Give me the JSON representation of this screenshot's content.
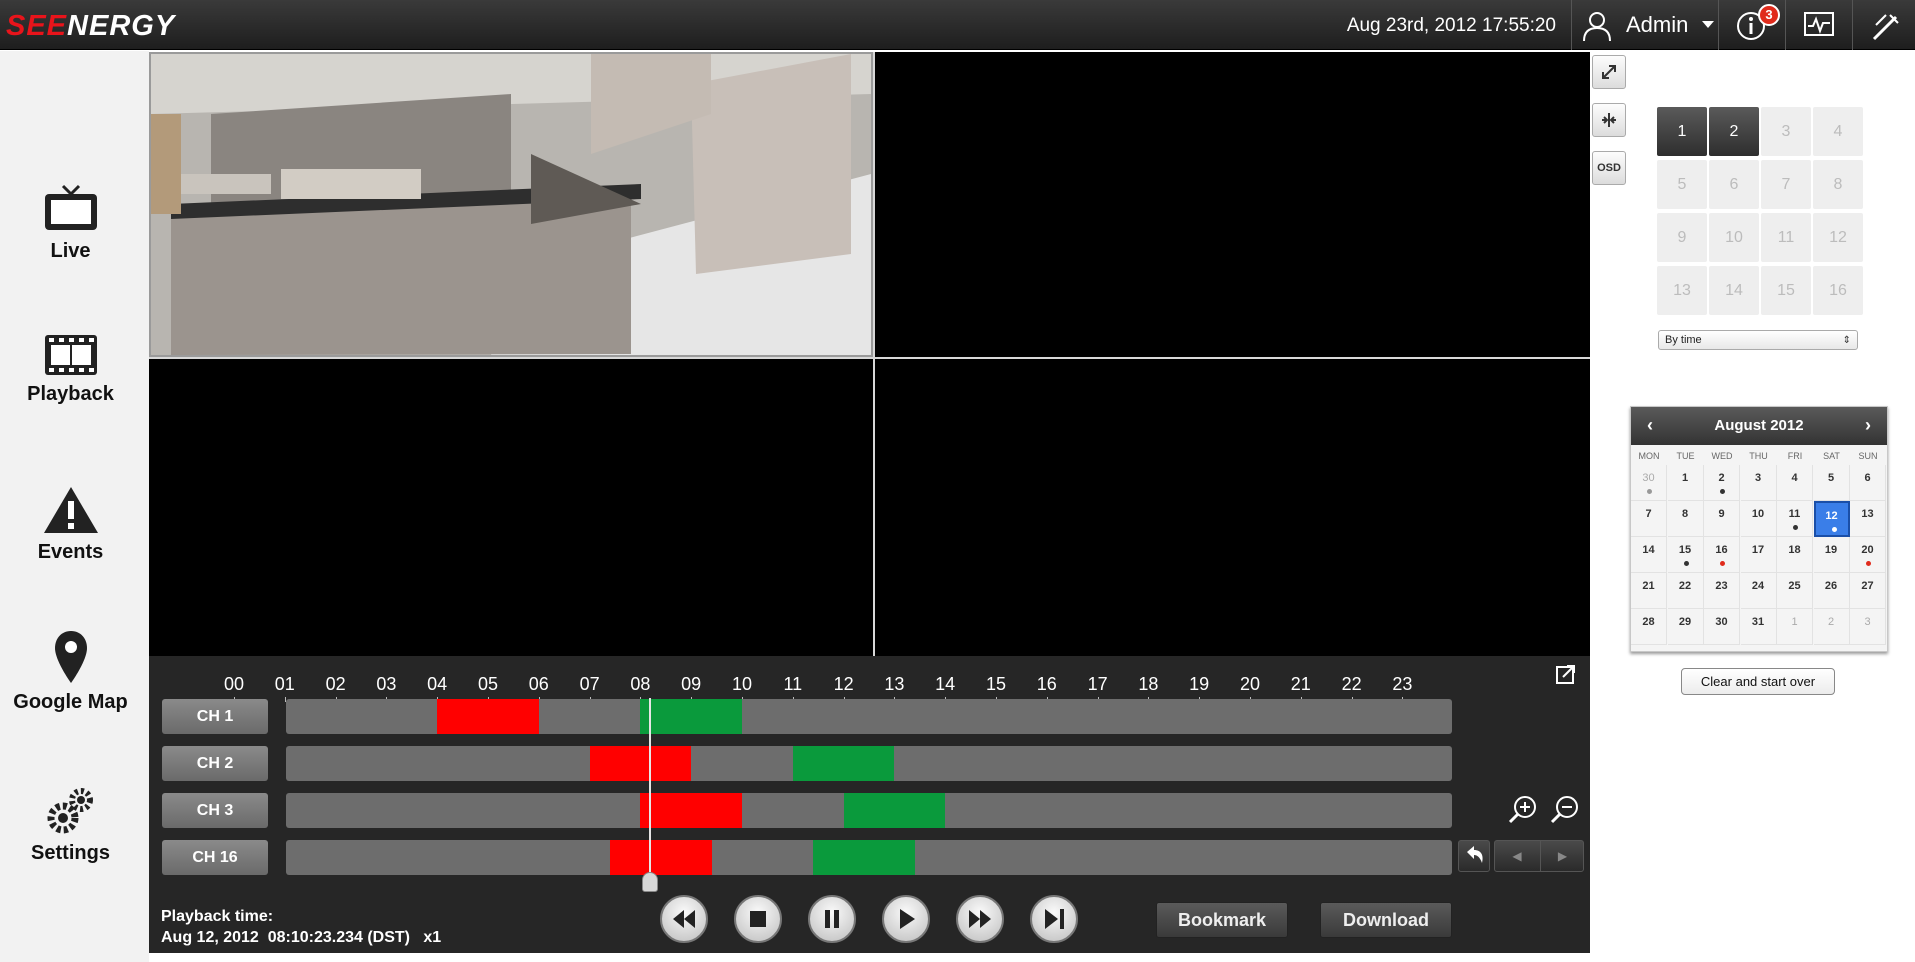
{
  "app": {
    "logo_prefix": "SEE",
    "logo_suffix": "NERGY"
  },
  "topbar": {
    "datetime": "Aug 23rd, 2012 17:55:20",
    "user": "Admin",
    "info_badge": "3",
    "icons": [
      "user-icon",
      "info-icon",
      "monitor-icon",
      "tools-icon"
    ]
  },
  "nav": [
    {
      "label": "Live",
      "icon": "tv-icon"
    },
    {
      "label": "Playback",
      "icon": "film-icon"
    },
    {
      "label": "Events",
      "icon": "warning-icon"
    },
    {
      "label": "Google Map",
      "icon": "map-pin-icon"
    },
    {
      "label": "Settings",
      "icon": "gears-icon"
    }
  ],
  "side_tools": {
    "fullscreen_icon": "expand-icon",
    "split_icon": "collapse-icon",
    "osd_label": "OSD"
  },
  "channels": {
    "labels": [
      "1",
      "2",
      "3",
      "4",
      "5",
      "6",
      "7",
      "8",
      "9",
      "10",
      "11",
      "12",
      "13",
      "14",
      "15",
      "16"
    ],
    "active": [
      "1",
      "2"
    ]
  },
  "mode_select": {
    "value": "By time"
  },
  "calendar": {
    "title": "August 2012",
    "weekdays": [
      "MON",
      "TUE",
      "WED",
      "THU",
      "FRI",
      "SAT",
      "SUN"
    ],
    "days": [
      "30",
      "1",
      "2",
      "3",
      "4",
      "5",
      "6",
      "7",
      "8",
      "9",
      "10",
      "11",
      "12",
      "13",
      "14",
      "15",
      "16",
      "17",
      "18",
      "19",
      "20",
      "21",
      "22",
      "23",
      "24",
      "25",
      "26",
      "27",
      "28",
      "29",
      "30",
      "31",
      "1",
      "2",
      "3"
    ],
    "selected": "12",
    "clear_label": "Clear and start over",
    "colors": {
      "dot_dark": "#333333",
      "dot_red": "#e02b1c",
      "dot_gray": "#999999",
      "selected": "#3a7ee8"
    }
  },
  "timeline": {
    "hours": [
      "00",
      "01",
      "02",
      "03",
      "04",
      "05",
      "06",
      "07",
      "08",
      "09",
      "10",
      "11",
      "12",
      "13",
      "14",
      "15",
      "16",
      "17",
      "18",
      "19",
      "20",
      "21",
      "22",
      "23"
    ],
    "channels": [
      {
        "label": "CH 1",
        "segments": [
          {
            "start": 4.0,
            "end": 6.0,
            "color": "#ff0000"
          },
          {
            "start": 8.0,
            "end": 10.0,
            "color": "#0a9a3c"
          }
        ]
      },
      {
        "label": "CH 2",
        "segments": [
          {
            "start": 7.0,
            "end": 9.0,
            "color": "#ff0000"
          },
          {
            "start": 11.0,
            "end": 13.0,
            "color": "#0a9a3c"
          }
        ]
      },
      {
        "label": "CH 3",
        "segments": [
          {
            "start": 8.0,
            "end": 10.0,
            "color": "#ff0000"
          },
          {
            "start": 12.0,
            "end": 14.0,
            "color": "#0a9a3c"
          }
        ]
      },
      {
        "label": "CH 16",
        "segments": [
          {
            "start": 7.4,
            "end": 9.4,
            "color": "#ff0000"
          },
          {
            "start": 11.4,
            "end": 13.4,
            "color": "#0a9a3c"
          }
        ]
      }
    ],
    "playhead_hour": 8.17,
    "playback_title": "Playback time:",
    "playback_value": "Aug 12, 2012  08:10:23.234 (DST)   x1",
    "controls": [
      "rewind-icon",
      "stop-icon",
      "pause-icon",
      "play-icon",
      "fast-forward-icon",
      "next-frame-icon"
    ],
    "bookmark_label": "Bookmark",
    "download_label": "Download"
  }
}
